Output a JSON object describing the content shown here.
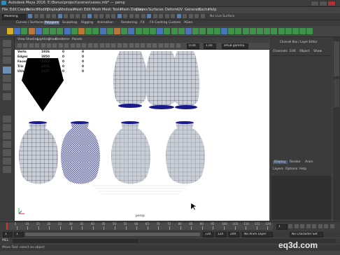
{
  "title": "Autodesk Maya 2016: E:\\Bonus\\project\\scenes\\vases.mb* --- persp",
  "menus": [
    "File",
    "Edit",
    "Create",
    "Select",
    "Modify",
    "Display",
    "Windows",
    "Mesh",
    "Edit Mesh",
    "Mesh Tools",
    "Mesh Display",
    "Curves",
    "Surfaces",
    "Deform",
    "UV",
    "Generate",
    "Cache",
    "Help"
  ],
  "status": {
    "mode": "Modeling",
    "live": "No Live Surface",
    "frame_value": "0.00",
    "scale_value": "1.00",
    "color_space": "sRGB gamma"
  },
  "shelf_tabs": [
    {
      "label": "Curves / Surfaces",
      "active": false
    },
    {
      "label": "Polygons",
      "active": true
    },
    {
      "label": "Sculpting",
      "active": false
    },
    {
      "label": "Rigging",
      "active": false
    },
    {
      "label": "Animation",
      "active": false
    },
    {
      "label": "Rendering",
      "active": false
    },
    {
      "label": "FX",
      "active": false
    },
    {
      "label": "FX Caching",
      "active": false
    },
    {
      "label": "Custom",
      "active": false
    },
    {
      "label": "XGen",
      "active": false
    }
  ],
  "viewport": {
    "menu": [
      "View",
      "Shading",
      "Lighting",
      "Show",
      "Renderer",
      "Panels"
    ],
    "camera": "persp",
    "hud": [
      {
        "label": "Verts",
        "a": "1926",
        "b": "0",
        "c": "0"
      },
      {
        "label": "Edges",
        "a": "3850",
        "b": "0",
        "c": "0"
      },
      {
        "label": "Faces",
        "a": "1632",
        "b": "0",
        "c": "0"
      },
      {
        "label": "Tris",
        "a": "2926",
        "b": "0",
        "c": "0"
      },
      {
        "label": "UVs",
        "a": "1677",
        "b": "0",
        "c": "0"
      }
    ]
  },
  "channel_box": {
    "title": "Channel Box / Layer Editor",
    "menu": [
      "Channels",
      "Edit",
      "Object",
      "Show"
    ]
  },
  "layer_editor": {
    "tabs": [
      "Display",
      "Render",
      "Anim"
    ],
    "menu": [
      "Layers",
      "Options",
      "Help"
    ]
  },
  "timeline": {
    "ticks": [
      "5",
      "10",
      "15",
      "20",
      "25",
      "30",
      "35",
      "40",
      "45",
      "50",
      "55",
      "60",
      "65",
      "70",
      "75",
      "80",
      "85",
      "90",
      "95",
      "100",
      "105",
      "110",
      "115",
      "120"
    ],
    "current": "1"
  },
  "range": {
    "start": "1",
    "inner_start": "1",
    "inner_end": "120",
    "end": "120",
    "end2": "200",
    "anim_layer": "No Anim Layer",
    "char_set": "No Character Set"
  },
  "cmd": {
    "label": "MEL"
  },
  "help": {
    "text": "Move Tool: select an object"
  },
  "watermark": "eq3d.com",
  "colors": {
    "accent": "#5a6b82",
    "wire": "#1a1a8a",
    "vase_fill": "#c9cdd6",
    "shelf_green": "#3ea04a",
    "shelf_blue": "#4a7bd0"
  }
}
